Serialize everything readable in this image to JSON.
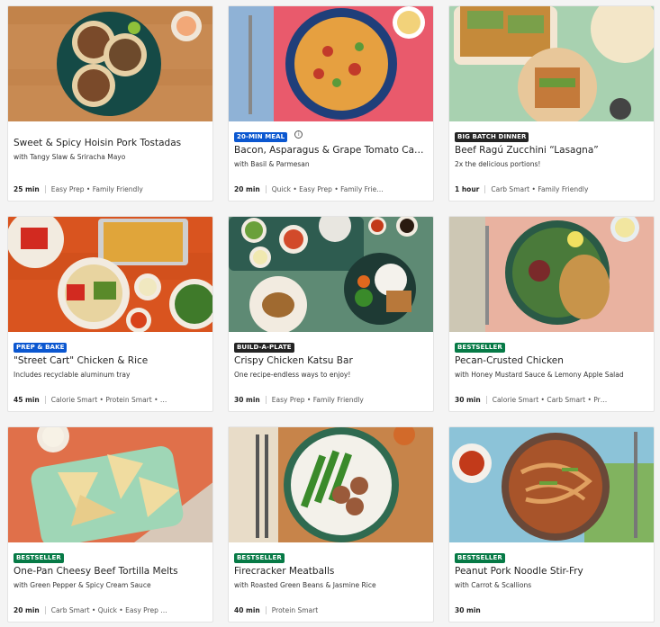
{
  "colors": {
    "badge_blue": "#0b57d0",
    "badge_dark": "#242424",
    "badge_green": "#067a46"
  },
  "cards": [
    {
      "title": "Sweet & Spicy Hoisin Pork Tostadas",
      "badge": "",
      "badge_color": "",
      "subtitle": "with Tangy Slaw & Sriracha Mayo",
      "time": "25 min",
      "tags": "Easy Prep • Family Friendly"
    },
    {
      "title": "Bacon, Asparagus & Grape Tomato Cava…",
      "badge": "20-MIN MEAL",
      "badge_color": "#0b57d0",
      "subtitle": "with Basil & Parmesan",
      "time": "20 min",
      "tags": "Quick • Easy Prep • Family Frie…",
      "info_icon": "info-icon"
    },
    {
      "title": "Beef Ragú Zucchini “Lasagna”",
      "badge": "BIG BATCH DINNER",
      "badge_color": "#242424",
      "subtitle": "2x the delicious portions!",
      "time": "1 hour",
      "tags": "Carb Smart • Family Friendly"
    },
    {
      "title": "\"Street Cart\" Chicken & Rice",
      "badge": "PREP & BAKE",
      "badge_color": "#0b57d0",
      "subtitle": "Includes recyclable aluminum tray",
      "time": "45 min",
      "tags": "Calorie Smart • Protein Smart • …"
    },
    {
      "title": "Crispy Chicken Katsu Bar",
      "badge": "BUILD-A-PLATE",
      "badge_color": "#242424",
      "subtitle": "One recipe-endless ways to enjoy!",
      "time": "30 min",
      "tags": "Easy Prep • Family Friendly"
    },
    {
      "title": "Pecan-Crusted Chicken",
      "badge": "BESTSELLER",
      "badge_color": "#067a46",
      "subtitle": "with Honey Mustard Sauce & Lemony Apple Salad",
      "time": "30 min",
      "tags": "Calorie Smart • Carb Smart • Pr…"
    },
    {
      "title": "One-Pan Cheesy Beef Tortilla Melts",
      "badge": "BESTSELLER",
      "badge_color": "#067a46",
      "subtitle": "with Green Pepper & Spicy Cream Sauce",
      "time": "20 min",
      "tags": "Carb Smart • Quick • Easy Prep …"
    },
    {
      "title": "Firecracker Meatballs",
      "badge": "BESTSELLER",
      "badge_color": "#067a46",
      "subtitle": "with Roasted Green Beans & Jasmine Rice",
      "time": "40 min",
      "tags": "Protein Smart"
    },
    {
      "title": "Peanut Pork Noodle Stir-Fry",
      "badge": "BESTSELLER",
      "badge_color": "#067a46",
      "subtitle": "with Carrot & Scallions",
      "time": "30 min",
      "tags": ""
    }
  ]
}
